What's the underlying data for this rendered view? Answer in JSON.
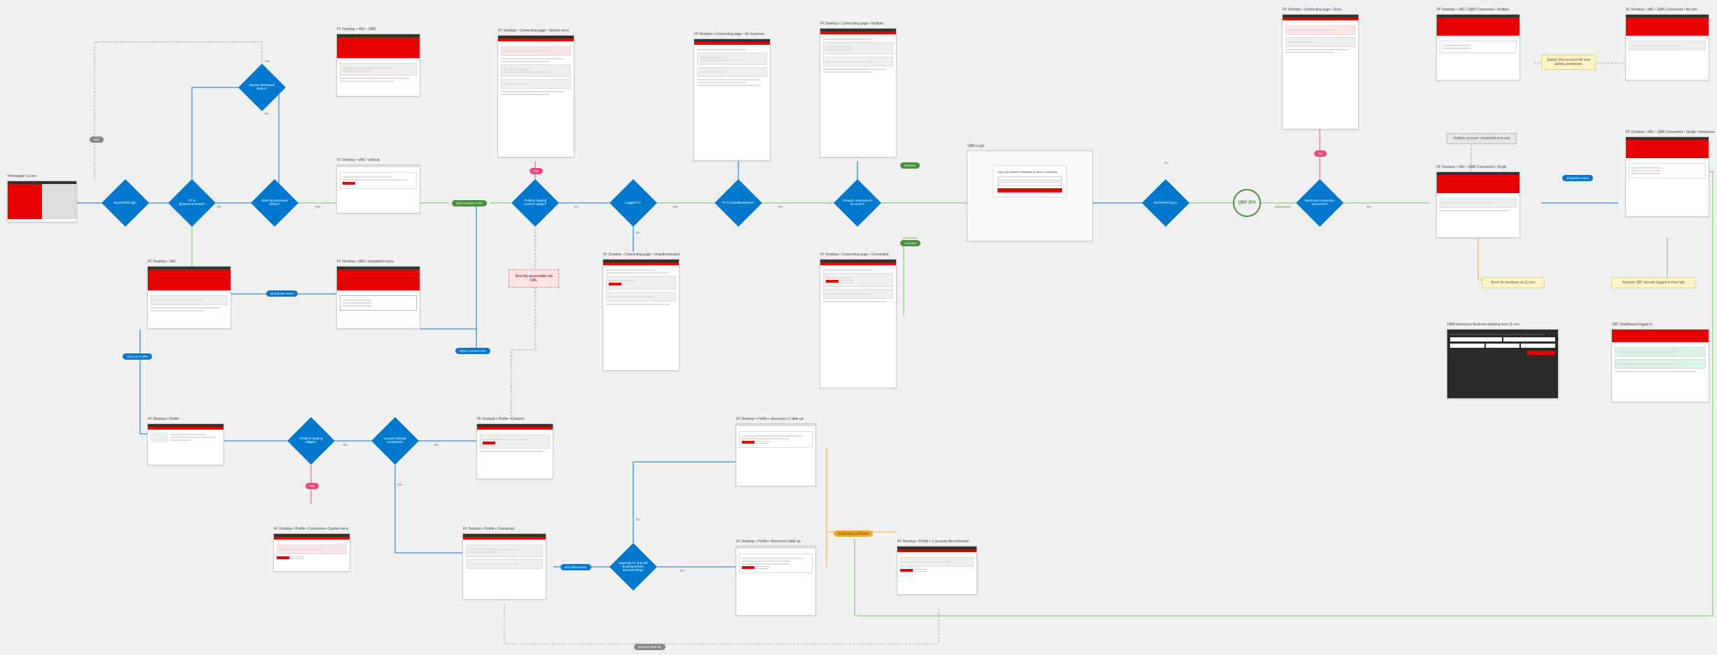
{
  "screens": {
    "homepage": {
      "label": "Homepage Q.com"
    },
    "vac_qbr": {
      "label": "FF Desktop • VAC • QBR"
    },
    "vac_slideup": {
      "label": "FF Desktop • VAC • slideup"
    },
    "vac": {
      "label": "FF Desktop • VAC"
    },
    "vac_dropdown": {
      "label": "FF Desktop • VAC • dropdown menu"
    },
    "connect_syserror": {
      "label": "FF Desktop • Connecting page • System error"
    },
    "connect_nobiz": {
      "label": "FF Desktop • Connecting page • No business"
    },
    "connect_multiple": {
      "label": "FF Desktop • Connecting page • Multiple"
    },
    "connect_unauth": {
      "label": "FF Desktop • Connecting page • Unauthenticated"
    },
    "connect_connected": {
      "label": "FF Desktop • Connecting page • Connected"
    },
    "connect_error2": {
      "label": "FF Desktop • Connecting page • Error"
    },
    "qbr_login": {
      "label": "QBR Login"
    },
    "vac_qbr_c_multi": {
      "label": "FF Desktop • VAC • QBR Connected • Multiple"
    },
    "vac_qbr_c_noinfo": {
      "label": "FF Desktop • VAC • QBR Connected • No info"
    },
    "vac_qbr_c_single": {
      "label": "FF Desktop • VAC • QBR Connected • Single"
    },
    "vac_qbr_c_single_dd": {
      "label": "FF Desktop • VAC • QBR Connected • Single • dropdown"
    },
    "fbm_biz_booking": {
      "label": "FBM interstress Business booking from Q.com"
    },
    "qbt_dashboard": {
      "label": "QBT Dashboard logged in"
    },
    "profile": {
      "label": "FF Desktop • Profile"
    },
    "profile_connect": {
      "label": "FF Desktop • Profile • Connect"
    },
    "profile_connected": {
      "label": "FF Desktop • Profile • Connected"
    },
    "profile_c_syserr": {
      "label": "FF Desktop • Profile • Connected • System error"
    },
    "profile_disc2": {
      "label": "FF Desktop • Profile • disconnect 2 slide up"
    },
    "profile_disc_slide": {
      "label": "FF Desktop • Profile • disconnect slide up"
    },
    "profile_1acc_disc": {
      "label": "FF Desktop • Profile • 1 account disconnected"
    }
  },
  "decisions": {
    "d_login": "Successful login",
    "d_ff_consent": "FF to QuantConsented?",
    "d_dismissed": "Banner dismissed before?",
    "d_slideup_dis": "Slide-up dismissed before?",
    "d_problem": "Problem loading connect widget?",
    "d_loggedin": "Logged in?",
    "d_ff_business": "FF to QuantBusiness?",
    "d_already": "Already connected to accounts?",
    "d_qbr_login": "Successful log in",
    "d_backend": "Back-end connection successful?",
    "d_loading": "Problem loading widget?",
    "d_acc_connected": "Account already connected?",
    "d_last_ff": "Last/only FF and self booking before disconnecting?"
  },
  "nodes": {
    "qbr2fa": "QBR 2FA"
  },
  "pills": {
    "exit": "Exit",
    "yes": "Yes",
    "no": "No",
    "dropdown": "Dropdown menu",
    "click_profile": "Click on Profile",
    "click_connect": "Click Connect CTA",
    "click_connect2": "Click Connect CTA",
    "dismiss": "Dismiss",
    "connect": "Connect",
    "click_disc": "click disconnect",
    "dismiss_slide": "Dismiss slide up",
    "disconnect_conf": "Disconnect Confirmed",
    "disconnect": "Disconnect",
    "dropdown_menu2": "dropdown menu"
  },
  "notes": {
    "directly": "Directly accessible via URL",
    "switch_2nd": "Switch 2nd account fail now admin permission",
    "multiple_scenario": "Multiple account connected scenario",
    "book_biz": "Book for business on Q.com",
    "assume_qbt": "Assume QBT already logged in from tab"
  },
  "qbr_login_box": {
    "title": "Log In to Business Rewards to finish connecting",
    "email_ph": "Email",
    "pw_ph": "Password",
    "btn": "Log in"
  }
}
